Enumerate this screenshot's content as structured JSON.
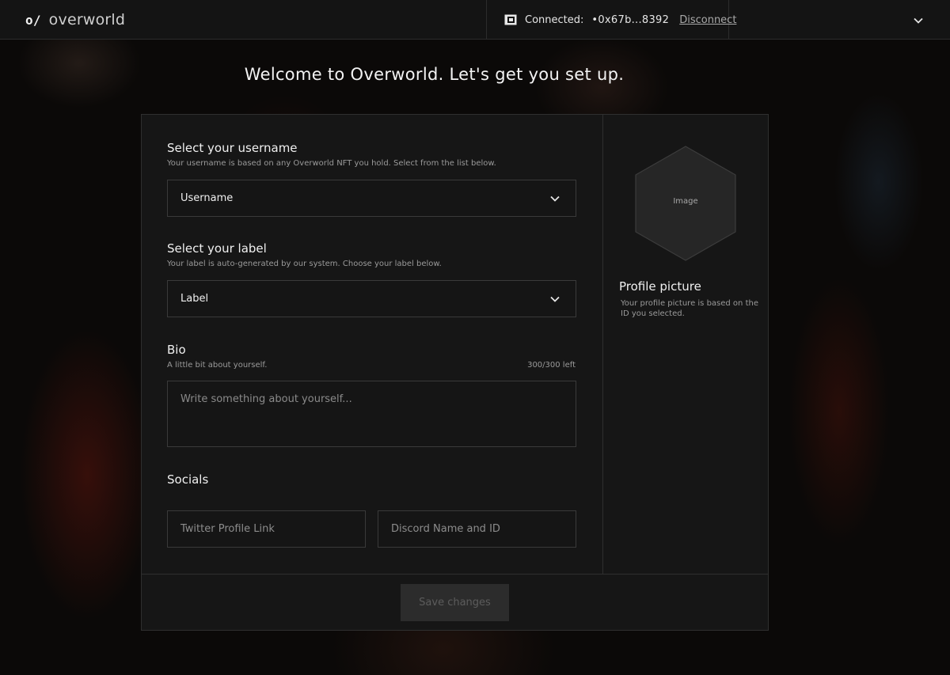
{
  "header": {
    "logo_mark": "o/",
    "logo_text": "overworld",
    "connected_label": "Connected:",
    "address": "•0x67b...8392",
    "disconnect_label": "Disconnect"
  },
  "page_title": "Welcome to Overworld. Let's get you set up.",
  "form": {
    "username": {
      "title": "Select your username",
      "help": "Your username is based on any Overworld NFT you hold. Select from the list below.",
      "selected": "Username"
    },
    "label": {
      "title": "Select your label",
      "help": "Your label is auto-generated by our system. Choose your label below.",
      "selected": "Label"
    },
    "bio": {
      "title": "Bio",
      "help": "A little bit about yourself.",
      "counter": "300/300 left",
      "placeholder": "Write something about yourself..."
    },
    "socials": {
      "title": "Socials",
      "twitter_placeholder": "Twitter Profile Link",
      "discord_placeholder": "Discord Name and ID"
    }
  },
  "profile": {
    "image_placeholder": "Image",
    "title": "Profile picture",
    "help": "Your profile picture is based on the ID you selected."
  },
  "footer": {
    "save_label": "Save changes"
  }
}
